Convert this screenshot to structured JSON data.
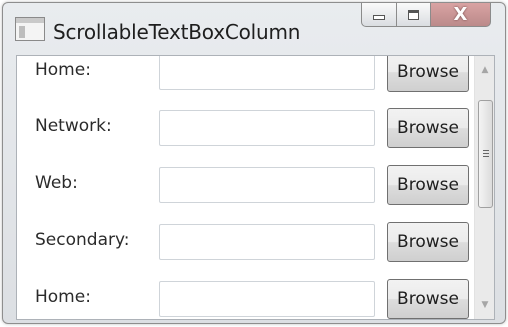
{
  "window": {
    "title": "ScrollableTextBoxColumn",
    "icons": {
      "app": "window-app-icon",
      "minimize": "minimize-icon",
      "maximize": "maximize-icon",
      "close": "close-icon"
    },
    "close_glyph": "X"
  },
  "rows": [
    {
      "label": "Home:",
      "value": "",
      "button": "Browse"
    },
    {
      "label": "Network:",
      "value": "",
      "button": "Browse"
    },
    {
      "label": "Web:",
      "value": "",
      "button": "Browse"
    },
    {
      "label": "Secondary:",
      "value": "",
      "button": "Browse"
    },
    {
      "label": "Home:",
      "value": "",
      "button": "Browse"
    }
  ],
  "scrollbar": {
    "up_icon": "scroll-up-arrow-icon",
    "down_icon": "scroll-down-arrow-icon",
    "up_glyph": "▲",
    "down_glyph": "▼"
  },
  "colors": {
    "close_button": "#c78f8f",
    "window_frame": "#dcdfe3"
  }
}
